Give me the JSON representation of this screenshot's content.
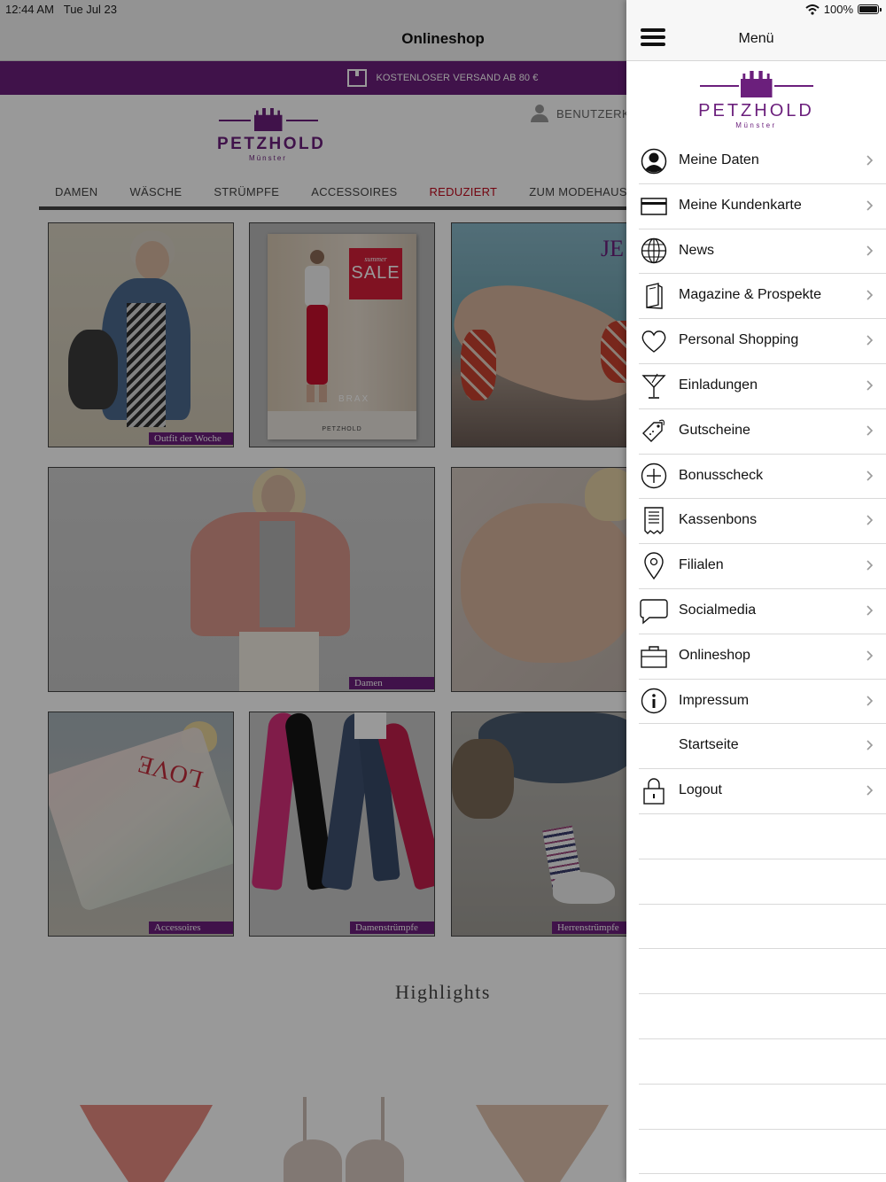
{
  "status_bar": {
    "time": "12:44 AM",
    "date": "Tue Jul 23",
    "battery": "100%"
  },
  "shop": {
    "title": "Onlineshop",
    "promo_text": "KOSTENLOSER VERSAND AB 80 €",
    "logo_word": "PETZHOLD",
    "logo_city": "Münster",
    "user_label": "BENUTZERK",
    "categories": [
      {
        "label": "DAMEN"
      },
      {
        "label": "WÄSCHE"
      },
      {
        "label": "STRÜMPFE"
      },
      {
        "label": "ACCESSOIRES"
      },
      {
        "label": "REDUZIERT"
      },
      {
        "label": "ZUM MODEHAUS"
      }
    ],
    "tiles": [
      {
        "caption": "Outfit der Woche"
      },
      {
        "poster_sale_small": "summer",
        "poster_sale_big": "SALE",
        "poster_brand": "BRAX",
        "poster_footer": "PETZHOLD"
      },
      {
        "partial_text": "JE"
      },
      {
        "caption": "Damen"
      },
      {
        "caption": ""
      },
      {
        "caption": "Accessoires"
      },
      {
        "caption": "Damenstrümpfe"
      },
      {
        "caption": "Herrenstrümpfe"
      }
    ],
    "highlights_title": "Highlights"
  },
  "drawer": {
    "title": "Menü",
    "logo_word": "PETZHOLD",
    "logo_city": "Münster",
    "items": [
      {
        "label": "Meine Daten",
        "icon": "user-circle-icon"
      },
      {
        "label": "Meine Kundenkarte",
        "icon": "card-icon"
      },
      {
        "label": "News",
        "icon": "globe-icon"
      },
      {
        "label": "Magazine & Prospekte",
        "icon": "magazine-icon"
      },
      {
        "label": "Personal Shopping",
        "icon": "heart-icon"
      },
      {
        "label": "Einladungen",
        "icon": "cocktail-icon"
      },
      {
        "label": "Gutscheine",
        "icon": "tag-icon"
      },
      {
        "label": "Bonusscheck",
        "icon": "plus-circle-icon"
      },
      {
        "label": "Kassenbons",
        "icon": "receipt-icon"
      },
      {
        "label": "Filialen",
        "icon": "location-pin-icon"
      },
      {
        "label": "Socialmedia",
        "icon": "chat-bubble-icon"
      },
      {
        "label": "Onlineshop",
        "icon": "shopping-bag-icon"
      },
      {
        "label": "Impressum",
        "icon": "info-icon"
      },
      {
        "label": "Startseite",
        "icon": ""
      },
      {
        "label": "Logout",
        "icon": "lock-icon"
      }
    ]
  }
}
